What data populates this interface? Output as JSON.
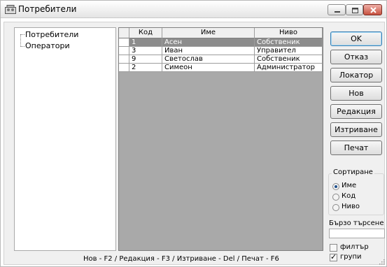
{
  "window": {
    "title": "Потребители",
    "controls": [
      "minimize-icon",
      "maximize-icon",
      "close-icon"
    ]
  },
  "tree": {
    "items": [
      {
        "label": "Потребители"
      },
      {
        "label": "Оператори"
      }
    ]
  },
  "grid": {
    "columns": [
      "Код",
      "Име",
      "Ниво"
    ],
    "rows": [
      {
        "code": "1",
        "name": "Асен",
        "level": "Собственик",
        "selected": true
      },
      {
        "code": "3",
        "name": "Иван",
        "level": "Управител",
        "selected": false
      },
      {
        "code": "9",
        "name": "Светослав",
        "level": "Собственик",
        "selected": false
      },
      {
        "code": "2",
        "name": "Симеон",
        "level": "Администратор",
        "selected": false
      }
    ]
  },
  "buttons": {
    "ok": "OK",
    "cancel": "Отказ",
    "locator": "Локатор",
    "new": "Нов",
    "edit": "Редакция",
    "delete": "Изтриване",
    "print": "Печат"
  },
  "sort": {
    "title": "Сортиране",
    "options": [
      {
        "label": "Име",
        "checked": true
      },
      {
        "label": "Код",
        "checked": false
      },
      {
        "label": "Ниво",
        "checked": false
      }
    ]
  },
  "quick_search": {
    "label": "Бързо търсене",
    "value": ""
  },
  "checkboxes": {
    "filter": {
      "label": "филтър",
      "checked": false
    },
    "groups": {
      "label": "групи",
      "checked": true
    }
  },
  "status": {
    "shortcuts": "Нов - F2 / Редакция - F3 / Изтриване - Del / Печат - F6"
  },
  "colors": {
    "selected_row": "#8c8c8c",
    "grid_background": "#a9a9a9",
    "panel": "#f0f0f0",
    "close_button": "#c7513f"
  }
}
